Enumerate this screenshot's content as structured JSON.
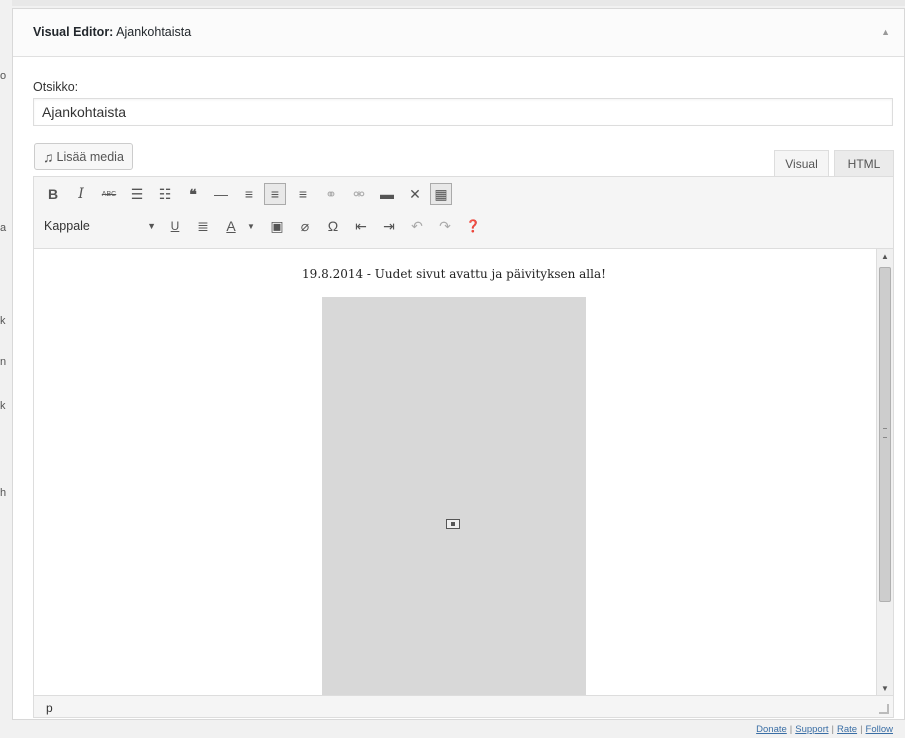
{
  "colors": {
    "page_bg": "#f1f1f1",
    "panel_bg": "#ffffff",
    "border": "#dddddd",
    "link": "#3a6ea5",
    "placeholder_gray": "#d8d8d8"
  },
  "panel": {
    "title_prefix": "Visual Editor:",
    "title_name": "Ajankohtaista",
    "collapse_icon": "arrow-up-icon"
  },
  "form": {
    "title_label": "Otsikko:",
    "title_value": "Ajankohtaista",
    "media_button_icon": "media-icon",
    "media_button_label": "Lisää media"
  },
  "tabs": [
    {
      "label": "Visual",
      "active": true
    },
    {
      "label": "HTML",
      "active": false
    }
  ],
  "toolbar_row1": [
    {
      "name": "bold",
      "glyph": "B"
    },
    {
      "name": "italic",
      "glyph": "I"
    },
    {
      "name": "strikethrough",
      "glyph": "ABC"
    },
    {
      "name": "bullet-list",
      "glyph": "☰"
    },
    {
      "name": "numbered-list",
      "glyph": "☷"
    },
    {
      "name": "blockquote",
      "glyph": "❝"
    },
    {
      "name": "horizontal-rule",
      "glyph": "—"
    },
    {
      "name": "align-left",
      "glyph": "≡"
    },
    {
      "name": "align-center",
      "glyph": "≡"
    },
    {
      "name": "align-right",
      "glyph": "≡"
    },
    {
      "name": "insert-link",
      "glyph": "🔗"
    },
    {
      "name": "remove-link",
      "glyph": "⛓"
    },
    {
      "name": "read-more",
      "glyph": "▬"
    },
    {
      "name": "fullscreen",
      "glyph": "⤧"
    },
    {
      "name": "toolbar-toggle",
      "glyph": "▦"
    }
  ],
  "toolbar_row2": {
    "format_select": "Kappale",
    "buttons": [
      {
        "name": "underline",
        "glyph": "U"
      },
      {
        "name": "justify",
        "glyph": "≣"
      },
      {
        "name": "text-color",
        "glyph": "A"
      },
      {
        "name": "paste-as-text",
        "glyph": "📋"
      },
      {
        "name": "clear-formatting",
        "glyph": "⌫"
      },
      {
        "name": "special-character",
        "glyph": "Ω"
      },
      {
        "name": "outdent",
        "glyph": "⇤"
      },
      {
        "name": "indent",
        "glyph": "⇥"
      },
      {
        "name": "undo",
        "glyph": "↶"
      },
      {
        "name": "redo",
        "glyph": "↷"
      },
      {
        "name": "help",
        "glyph": "?"
      }
    ]
  },
  "content": {
    "first_line": "19.8.2014 - Uudet sivut avattu ja päivityksen alla!",
    "image_icon": "broken-image-icon"
  },
  "status_bar": {
    "path": "p"
  },
  "footer": {
    "links": [
      "Donate",
      "Support",
      "Rate",
      "Follow"
    ]
  }
}
